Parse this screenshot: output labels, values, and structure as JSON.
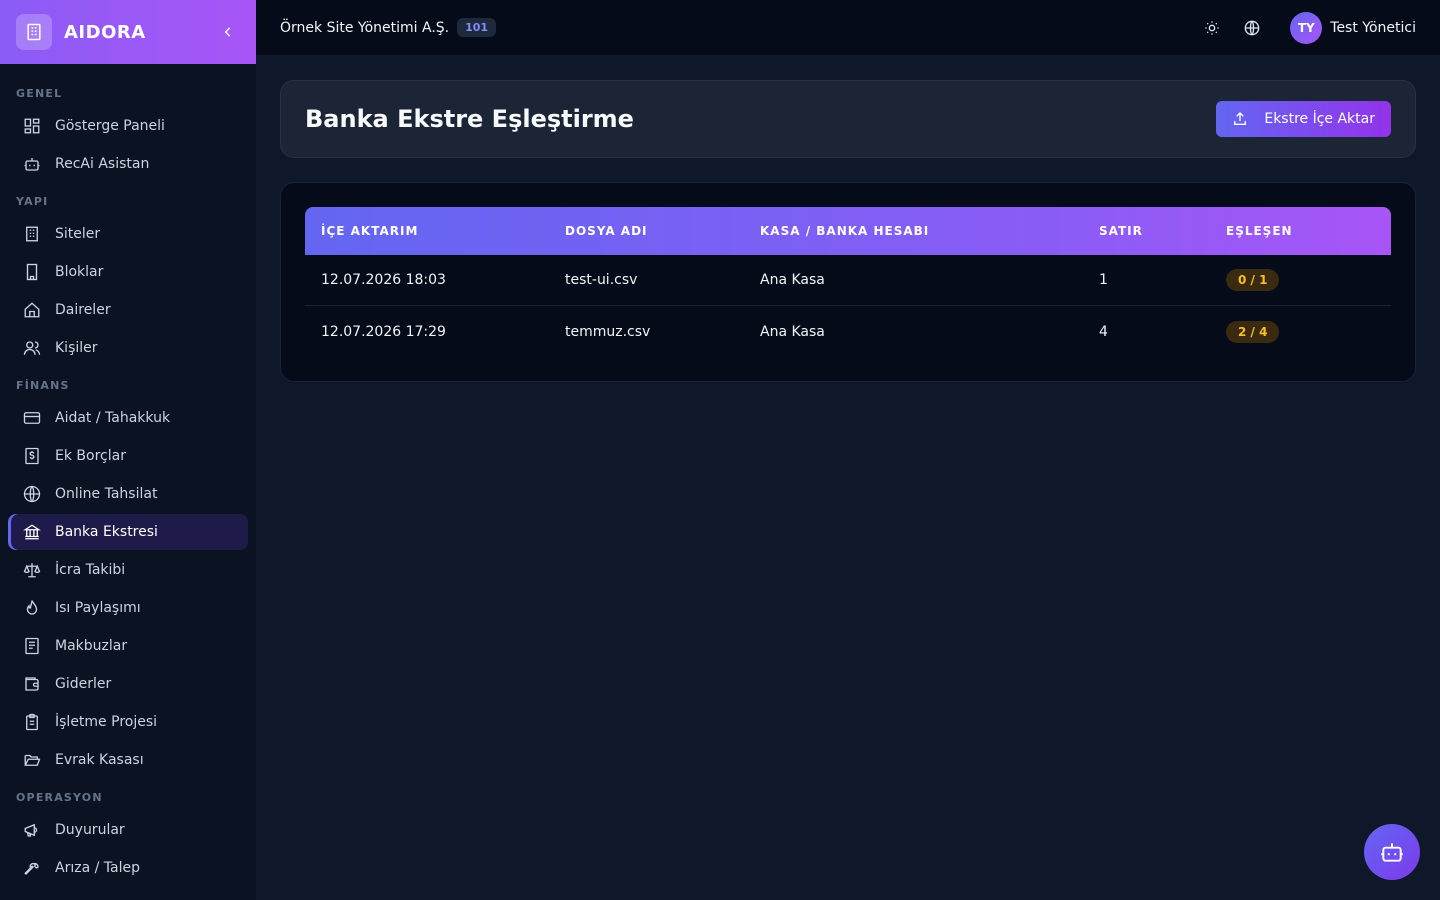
{
  "brand": {
    "name": "AIDORA"
  },
  "sidebar": {
    "sections": [
      {
        "title": "GENEL",
        "items": [
          {
            "label": "Gösterge Paneli",
            "icon": "dashboard-icon"
          },
          {
            "label": "RecAi Asistan",
            "icon": "bot-icon"
          }
        ]
      },
      {
        "title": "YAPI",
        "items": [
          {
            "label": "Siteler",
            "icon": "building-icon"
          },
          {
            "label": "Bloklar",
            "icon": "building-2-icon"
          },
          {
            "label": "Daireler",
            "icon": "home-icon"
          },
          {
            "label": "Kişiler",
            "icon": "users-icon"
          }
        ]
      },
      {
        "title": "FİNANS",
        "items": [
          {
            "label": "Aidat / Tahakkuk",
            "icon": "credit-card-icon"
          },
          {
            "label": "Ek Borçlar",
            "icon": "receipt-dollar-icon"
          },
          {
            "label": "Online Tahsilat",
            "icon": "globe-icon"
          },
          {
            "label": "Banka Ekstresi",
            "icon": "bank-icon",
            "active": true
          },
          {
            "label": "İcra Takibi",
            "icon": "scale-icon"
          },
          {
            "label": "Isı Paylaşımı",
            "icon": "flame-icon"
          },
          {
            "label": "Makbuzlar",
            "icon": "document-icon"
          },
          {
            "label": "Giderler",
            "icon": "wallet-icon"
          },
          {
            "label": "İşletme Projesi",
            "icon": "clipboard-icon"
          },
          {
            "label": "Evrak Kasası",
            "icon": "folder-open-icon"
          }
        ]
      },
      {
        "title": "OPERASYON",
        "items": [
          {
            "label": "Duyurular",
            "icon": "megaphone-icon"
          },
          {
            "label": "Arıza / Talep",
            "icon": "wrench-icon"
          }
        ]
      }
    ]
  },
  "topbar": {
    "org_name": "Örnek Site Yönetimi A.Ş.",
    "org_badge": "101",
    "user_initials": "TY",
    "user_name": "Test Yönetici"
  },
  "page": {
    "title": "Banka Ekstre Eşleştirme",
    "import_button": "Ekstre İçe Aktar"
  },
  "table": {
    "columns": [
      "İÇE AKTARIM",
      "DOSYA ADI",
      "KASA / BANKA HESABI",
      "SATIR",
      "EŞLEŞEN"
    ],
    "rows": [
      {
        "date": "12.07.2026 18:03",
        "file": "test-ui.csv",
        "account": "Ana Kasa",
        "rows": "1",
        "matched": "0 / 1"
      },
      {
        "date": "12.07.2026 17:29",
        "file": "temmuz.csv",
        "account": "Ana Kasa",
        "rows": "4",
        "matched": "2 / 4"
      }
    ]
  },
  "colors": {
    "accent": "#6366f1",
    "accent2": "#a855f7",
    "badge_text": "#fbbf24"
  }
}
